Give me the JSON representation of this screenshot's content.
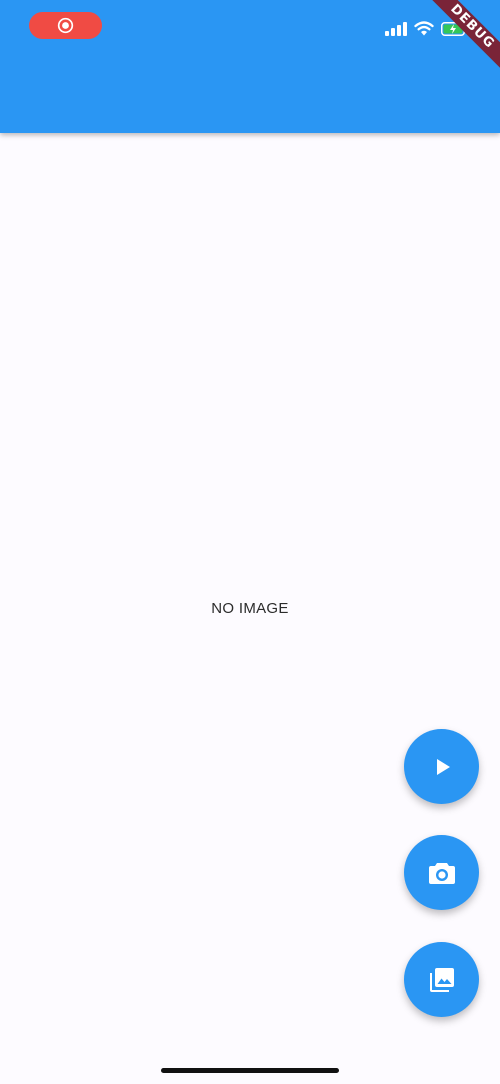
{
  "status_bar": {
    "record_icon": "screen-record-icon",
    "signal_icon": "cellular-signal-icon",
    "wifi_icon": "wifi-icon",
    "battery_icon": "battery-charging-icon"
  },
  "debug_banner": {
    "label": "DEBUG"
  },
  "main": {
    "placeholder_text": "NO IMAGE"
  },
  "fabs": [
    {
      "icon": "play-icon"
    },
    {
      "icon": "camera-icon"
    },
    {
      "icon": "photo-library-icon"
    }
  ],
  "colors": {
    "app_bar": "#2a96f3",
    "background": "#fdfbff",
    "record_pill": "#f04b44",
    "fab": "#2a96f3",
    "debug_banner": "#7a2438",
    "battery_fill": "#34c759"
  }
}
